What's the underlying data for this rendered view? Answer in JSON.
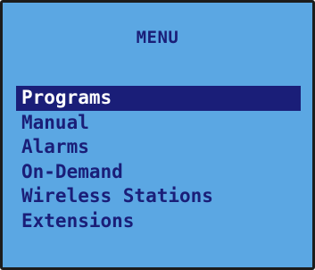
{
  "menu": {
    "title": "MENU",
    "selected_index": 0,
    "items": [
      {
        "label": "Programs"
      },
      {
        "label": "Manual"
      },
      {
        "label": "Alarms"
      },
      {
        "label": "On-Demand"
      },
      {
        "label": "Wireless Stations"
      },
      {
        "label": "Extensions"
      }
    ]
  },
  "colors": {
    "background": "#5ba7e3",
    "text": "#1a1e78",
    "highlight": "#1a1e78",
    "highlight_text": "#ffffff",
    "border": "#1c1c1c"
  }
}
